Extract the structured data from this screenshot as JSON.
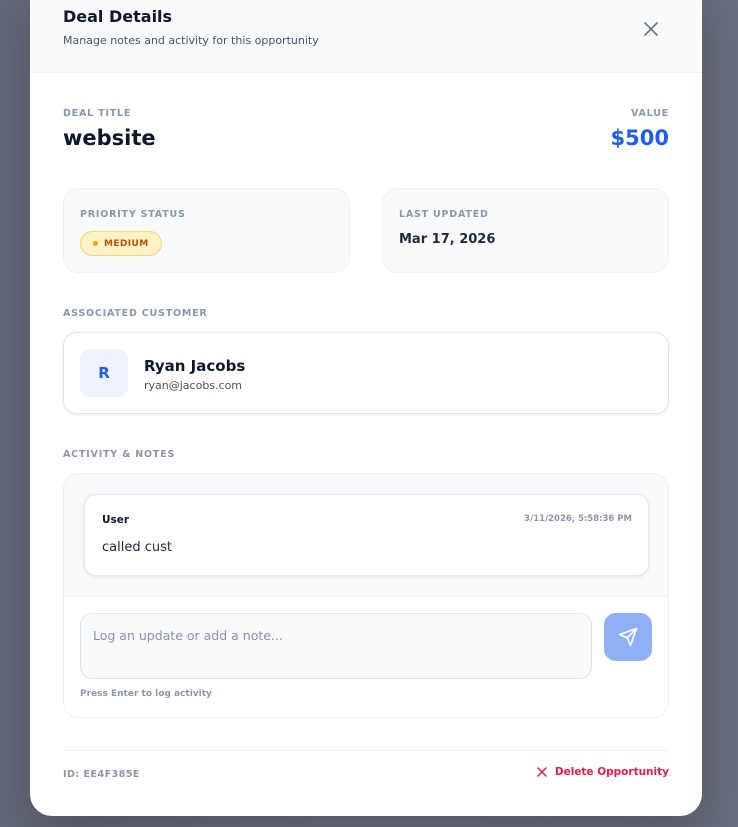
{
  "modal": {
    "title": "Deal Details",
    "subtitle": "Manage notes and activity for this opportunity"
  },
  "deal": {
    "title_label": "DEAL TITLE",
    "title": "website",
    "value_label": "VALUE",
    "value": "$500"
  },
  "priority": {
    "label": "PRIORITY STATUS",
    "badge": "MEDIUM"
  },
  "updated": {
    "label": "LAST UPDATED",
    "date": "Mar 17, 2026"
  },
  "customer": {
    "section_label": "ASSOCIATED CUSTOMER",
    "initial": "R",
    "name": "Ryan Jacobs",
    "email": "ryan@jacobs.com"
  },
  "activity": {
    "section_label": "ACTIVITY & NOTES",
    "notes": [
      {
        "author": "User",
        "timestamp": "3/11/2026, 5:58:36 PM",
        "text": "called cust"
      }
    ],
    "input_placeholder": "Log an update or add a note...",
    "hint": "Press Enter to log activity"
  },
  "footer": {
    "id": "ID: EE4F385E",
    "delete_label": "Delete Opportunity"
  },
  "icons": {
    "close": "close-icon",
    "send": "send-icon",
    "delete": "x-icon"
  },
  "colors": {
    "accent": "#1d5ef0",
    "danger": "#e11d48",
    "badge_bg": "#fdf1c6",
    "badge_text": "#b45309"
  }
}
